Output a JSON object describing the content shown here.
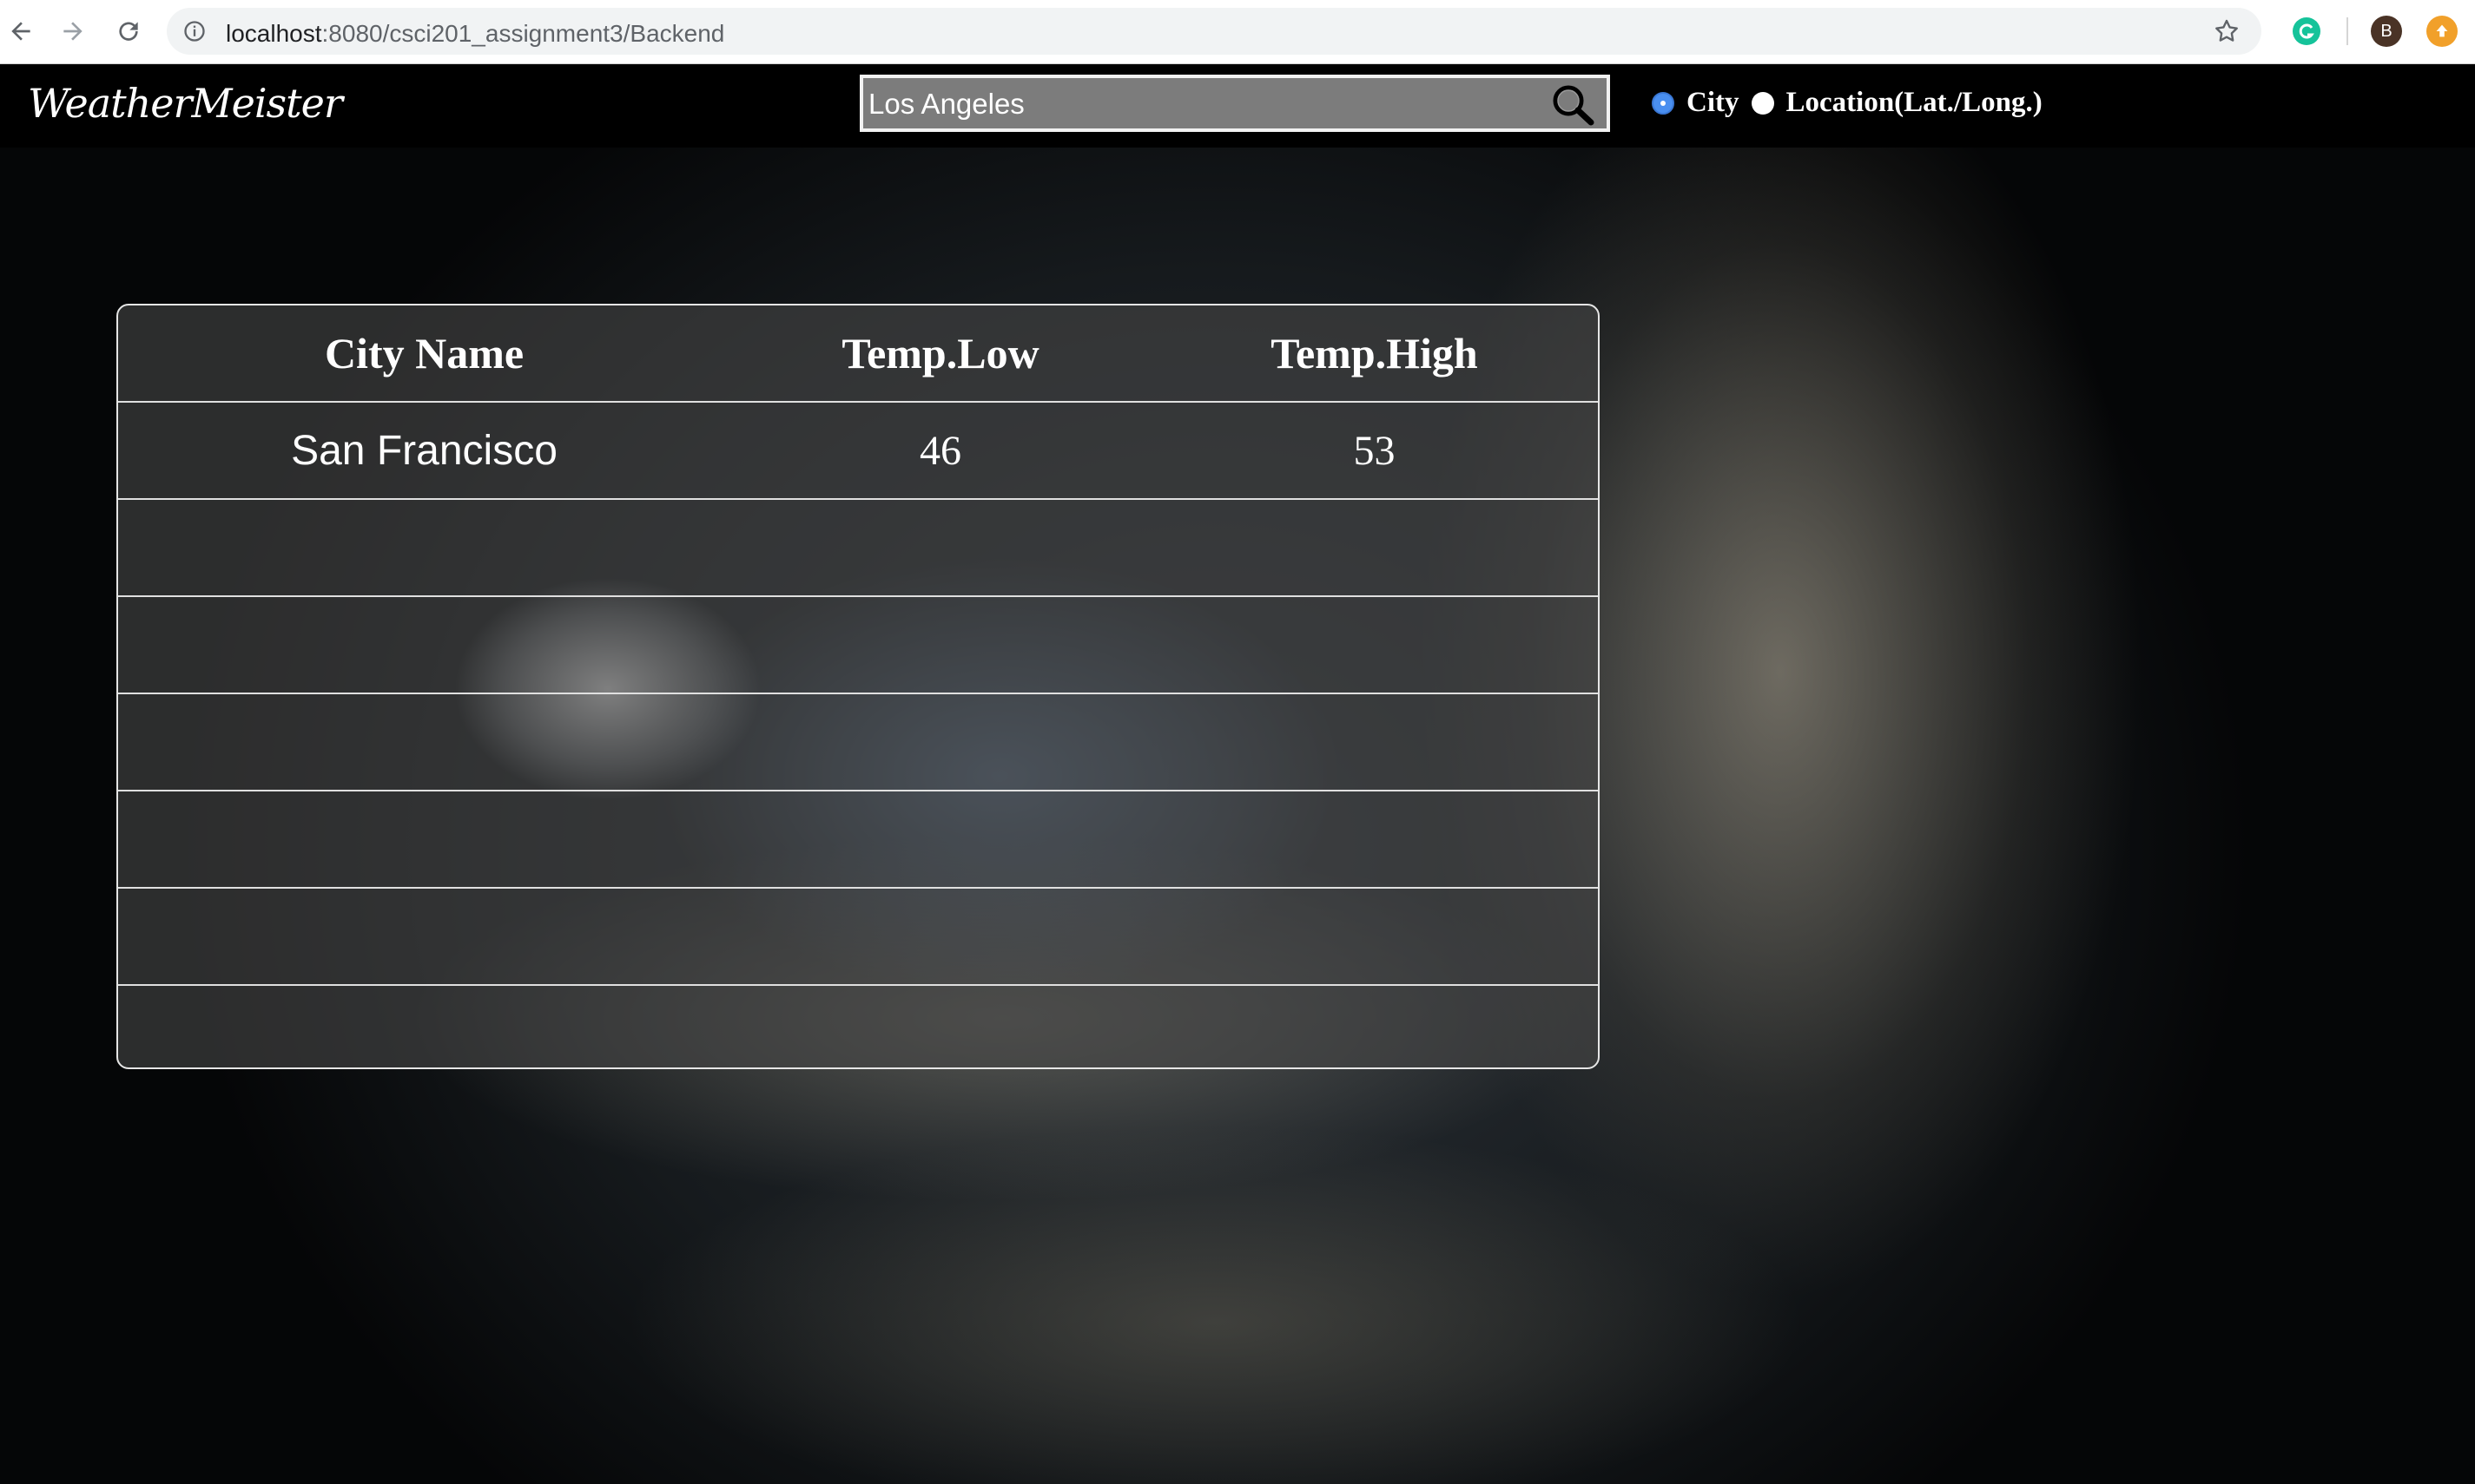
{
  "browser": {
    "url_host": "localhost",
    "url_rest": ":8080/csci201_assignment3/Backend",
    "ext_b_label": "B"
  },
  "header": {
    "logo": "WeatherMeister",
    "search_value": "Los Angeles",
    "radio_city": "City",
    "radio_location": "Location(Lat./Long.)",
    "selected_mode": "City"
  },
  "table": {
    "headers": [
      "City Name",
      "Temp.Low",
      "Temp.High"
    ],
    "rows": [
      [
        "San Francisco",
        "46",
        "53"
      ],
      [
        "",
        "",
        ""
      ],
      [
        "",
        "",
        ""
      ],
      [
        "",
        "",
        ""
      ],
      [
        "",
        "",
        ""
      ],
      [
        "",
        "",
        ""
      ],
      [
        "",
        "",
        ""
      ]
    ]
  },
  "colors": {
    "radio_selected": "#4a8ff0",
    "topbar": "#000000",
    "search_bg": "#7c7c7c"
  }
}
